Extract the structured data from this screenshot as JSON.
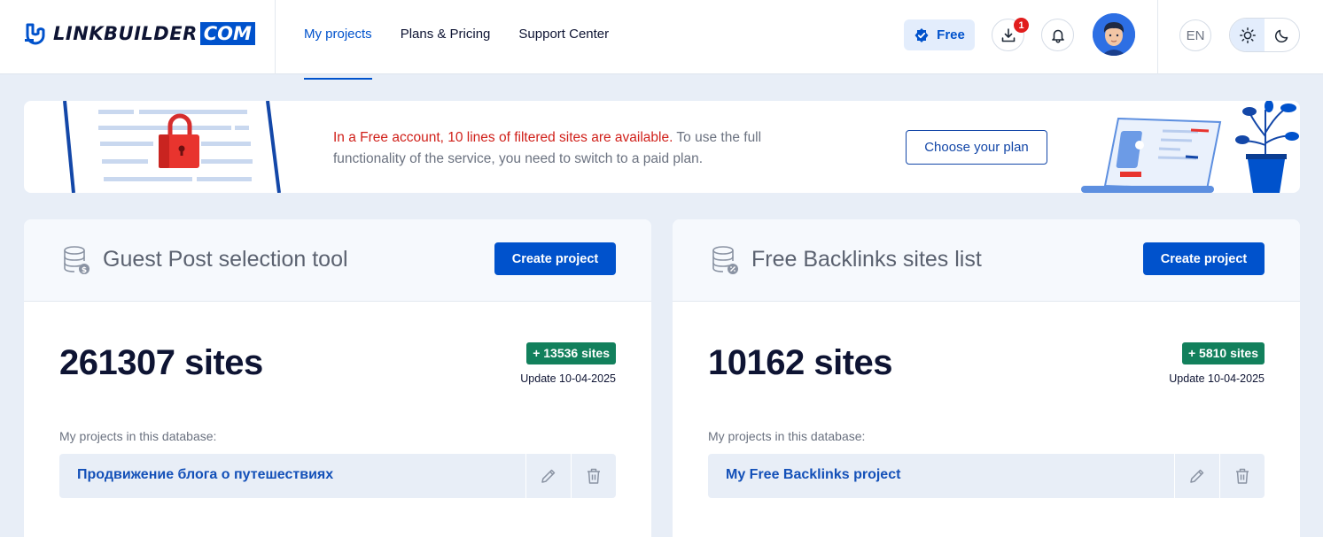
{
  "brand": {
    "name": "LINKBUILDER",
    "suffix": "COM"
  },
  "nav": {
    "items": [
      {
        "label": "My projects",
        "active": true
      },
      {
        "label": "Plans & Pricing"
      },
      {
        "label": "Support Center"
      }
    ]
  },
  "account": {
    "plan_badge": "Free",
    "downloads_count": "1",
    "language": "EN"
  },
  "banner": {
    "highlight": "In a Free account, 10 lines of filtered sites are available.",
    "text": " To use the full functionality of the service, you need to switch to a paid plan.",
    "button": "Choose your plan"
  },
  "cards": [
    {
      "title": "Guest Post selection tool",
      "create_label": "Create project",
      "count": "261307 sites",
      "delta": "+ 13536 sites",
      "update": "Update 10-04-2025",
      "projects_label": "My projects in this database:",
      "project_name": "Продвижение блога о путешествиях",
      "icon": "database-dollar-icon"
    },
    {
      "title": "Free Backlinks sites list",
      "create_label": "Create project",
      "count": "10162 sites",
      "delta": "+ 5810 sites",
      "update": "Update 10-04-2025",
      "projects_label": "My projects in this database:",
      "project_name": "My Free Backlinks project",
      "icon": "database-percent-icon"
    }
  ],
  "colors": {
    "accent": "#0052cc",
    "success": "#12805c",
    "alert": "#d0201a",
    "background": "#e8eef7"
  }
}
